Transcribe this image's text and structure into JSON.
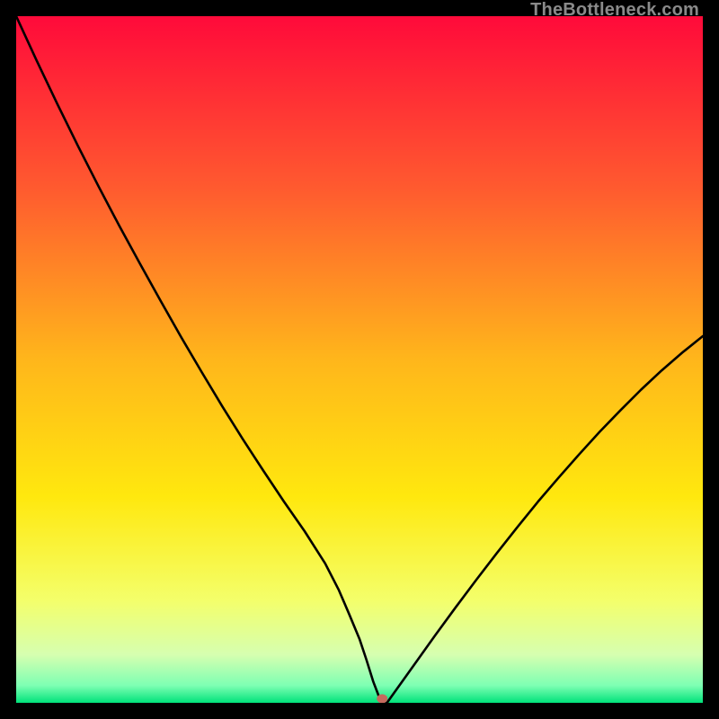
{
  "watermark": "TheBottleneck.com",
  "chart_data": {
    "type": "line",
    "title": "",
    "xlabel": "",
    "ylabel": "",
    "xlim": [
      0,
      100
    ],
    "ylim": [
      0,
      100
    ],
    "grid": false,
    "legend_position": "none",
    "gradient_stops": [
      {
        "offset": 0.0,
        "color": "#ff0a3a"
      },
      {
        "offset": 0.25,
        "color": "#ff5a2f"
      },
      {
        "offset": 0.5,
        "color": "#ffb61b"
      },
      {
        "offset": 0.7,
        "color": "#ffe80e"
      },
      {
        "offset": 0.85,
        "color": "#f4ff6a"
      },
      {
        "offset": 0.93,
        "color": "#d6ffb0"
      },
      {
        "offset": 0.975,
        "color": "#7dffb3"
      },
      {
        "offset": 1.0,
        "color": "#00e27a"
      }
    ],
    "series": [
      {
        "name": "bottleneck-curve",
        "color": "#000000",
        "stroke_width": 2.6,
        "x": [
          0,
          3,
          6,
          9,
          12,
          15,
          18,
          21,
          24,
          27,
          30,
          33,
          36,
          39,
          42,
          45,
          47,
          48.5,
          50,
          51,
          52,
          52.8,
          53.3,
          54,
          56,
          58,
          61,
          64,
          67,
          70,
          73,
          76,
          79,
          82,
          85,
          88,
          91,
          94,
          97,
          100
        ],
        "y": [
          100,
          93.5,
          87.2,
          81.1,
          75.2,
          69.5,
          64.0,
          58.6,
          53.3,
          48.2,
          43.2,
          38.4,
          33.8,
          29.3,
          25.0,
          20.3,
          16.4,
          12.9,
          9.3,
          6.3,
          3.1,
          1.0,
          0.0,
          0.0,
          2.8,
          5.6,
          9.8,
          13.9,
          17.9,
          21.8,
          25.6,
          29.3,
          32.8,
          36.2,
          39.5,
          42.6,
          45.6,
          48.4,
          51.0,
          53.4
        ]
      }
    ],
    "marker": {
      "x": 53.3,
      "y": 0.6,
      "rx": 6,
      "ry": 5,
      "color": "#c66a5e"
    }
  }
}
